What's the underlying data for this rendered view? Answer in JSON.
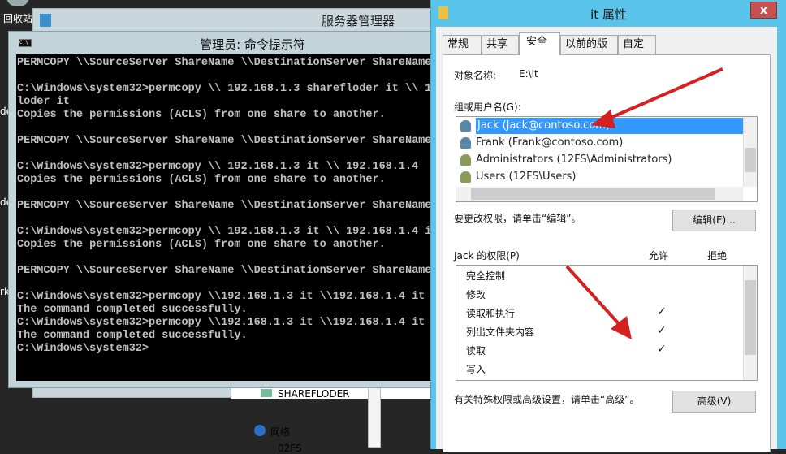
{
  "desktop": {
    "icons": [
      {
        "label": "回收站"
      },
      {
        "label": "de"
      },
      {
        "label": "de"
      },
      {
        "label": "rk"
      }
    ]
  },
  "server_manager": {
    "title": "服务器管理器",
    "tree": [
      {
        "label": "SHAREFLODER"
      },
      {
        "label": "网络"
      },
      {
        "label": "02FS"
      }
    ]
  },
  "cmd": {
    "title": "管理员: 命令提示符",
    "lines": [
      "PERMCOPY \\\\SourceServer ShareName \\\\DestinationServer ShareName",
      "",
      "C:\\Windows\\system32>permcopy \\\\ 192.168.1.3 sharefloder it \\\\ 19",
      "loder it",
      "Copies the permissions (ACLS) from one share to another.",
      "",
      "PERMCOPY \\\\SourceServer ShareName \\\\DestinationServer ShareName",
      "",
      "C:\\Windows\\system32>permcopy \\\\ 192.168.1.3 it \\\\ 192.168.1.4  i",
      "Copies the permissions (ACLS) from one share to another.",
      "",
      "PERMCOPY \\\\SourceServer ShareName \\\\DestinationServer ShareName",
      "",
      "C:\\Windows\\system32>permcopy \\\\ 192.168.1.3 it \\\\ 192.168.1.4 it",
      "Copies the permissions (ACLS) from one share to another.",
      "",
      "PERMCOPY \\\\SourceServer ShareName \\\\DestinationServer ShareName",
      "",
      "C:\\Windows\\system32>permcopy \\\\192.168.1.3 it \\\\192.168.1.4 it",
      "The command completed successfully.",
      "C:\\Windows\\system32>permcopy \\\\192.168.1.3 it \\\\192.168.1.4 it",
      "The command completed successfully.",
      "C:\\Windows\\system32>"
    ]
  },
  "dialog": {
    "title": "it 属性",
    "close": "x",
    "tabs": [
      {
        "label": "常规"
      },
      {
        "label": "共享"
      },
      {
        "label": "安全",
        "selected": true
      },
      {
        "label": "以前的版本"
      },
      {
        "label": "自定义"
      }
    ],
    "object_label": "对象名称:",
    "object_value": "E:\\it",
    "group_label": "组或用户名(G):",
    "users": [
      {
        "name": "Jack (Jack@contoso.com)",
        "icon": "user-icon",
        "selected": true
      },
      {
        "name": "Frank (Frank@contoso.com)",
        "icon": "user-icon"
      },
      {
        "name": "Administrators (12FS\\Administrators)",
        "icon": "group-icon"
      },
      {
        "name": "Users (12FS\\Users)",
        "icon": "group-icon"
      }
    ],
    "edit_hint": "要更改权限，请单击“编辑”。",
    "edit_button": "编辑(E)...",
    "perm_label": "Jack 的权限(P)",
    "allow": "允许",
    "deny": "拒绝",
    "permissions": [
      {
        "name": "完全控制",
        "allow": false
      },
      {
        "name": "修改",
        "allow": false
      },
      {
        "name": "读取和执行",
        "allow": true
      },
      {
        "name": "列出文件夹内容",
        "allow": true
      },
      {
        "name": "读取",
        "allow": true
      },
      {
        "name": "写入",
        "allow": false
      }
    ],
    "check": "✓",
    "advanced_hint": "有关特殊权限或高级设置，请单击“高级”。",
    "advanced_button": "高级(V)"
  },
  "colors": {
    "accent": "#5bc4ea",
    "selection": "#3399ff",
    "arrow": "#d42020",
    "close": "#c75050"
  }
}
